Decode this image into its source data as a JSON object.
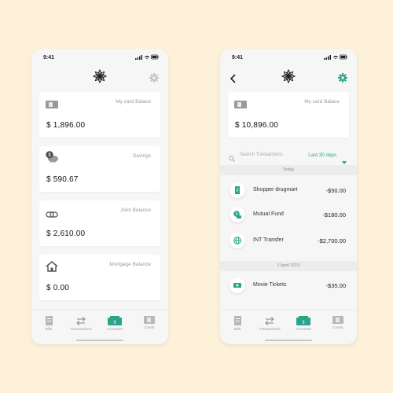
{
  "colors": {
    "background": "#fdf1d9",
    "accent": "#2aa58a",
    "phone_bg": "#f6f6f6"
  },
  "left_phone": {
    "status": {
      "time": "9:41"
    },
    "cards": [
      {
        "icon": "credit-card-icon",
        "label": "My card Balace",
        "amount": "$ 1,896.00"
      },
      {
        "icon": "piggy-bank-icon",
        "label": "Savings",
        "amount": "$ 590.67"
      },
      {
        "icon": "link-icon",
        "label": "Joint Balance",
        "amount": "$ 2,610.00"
      },
      {
        "icon": "house-icon",
        "label": "Mortgage Balance",
        "amount": "$ 0.00"
      }
    ]
  },
  "right_phone": {
    "status": {
      "time": "9:41"
    },
    "card": {
      "icon": "credit-card-icon",
      "label": "My card Balace",
      "amount": "$ 10,896.00"
    },
    "search": {
      "placeholder": "Search Transactions",
      "filter": "Last 30 days"
    },
    "sections": [
      {
        "label": "Today",
        "transactions": [
          {
            "icon": "receipt-icon",
            "name": "Shopper drugmart",
            "amount": "-$50.00"
          },
          {
            "icon": "coins-icon",
            "name": "Mutual Fund",
            "amount": "-$180.00"
          },
          {
            "icon": "globe-icon",
            "name": "INT Transfer",
            "amount": "-$2,700.00"
          }
        ]
      },
      {
        "label": "1 April 2019",
        "transactions": [
          {
            "icon": "banknote-icon",
            "name": "Movie Tickets",
            "amount": "-$35.00"
          }
        ]
      }
    ]
  },
  "tabbar": {
    "tabs": [
      {
        "label": "Bills",
        "icon": "bill-icon",
        "active": false
      },
      {
        "label": "Transactions",
        "icon": "transfer-arrows-icon",
        "active": false
      },
      {
        "label": "Accounts",
        "icon": "accounts-icon",
        "active": true
      },
      {
        "label": "Cards",
        "icon": "card-icon",
        "active": false
      }
    ]
  }
}
